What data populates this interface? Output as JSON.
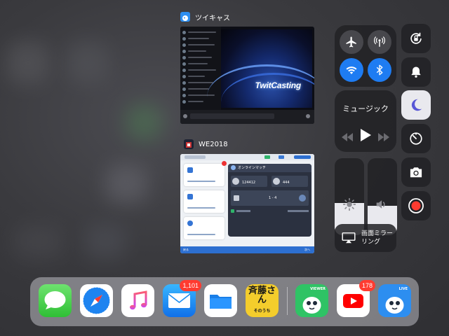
{
  "switcher": {
    "apps": [
      {
        "title": "ツイキャス",
        "preview_logo": "TwitCasting"
      },
      {
        "title": "WE2018",
        "panel_title": "オンラインマッチ",
        "stat_1": "124412",
        "stat_2": "444",
        "score": "1 - 4",
        "back_label": "戻る",
        "next_label": "次へ"
      }
    ]
  },
  "control_center": {
    "connectivity": {
      "airplane": {
        "icon": "airplane-icon",
        "active": false
      },
      "cellular": {
        "icon": "antenna-icon",
        "active": false
      },
      "wifi": {
        "icon": "wifi-icon",
        "active": true
      },
      "bluetooth": {
        "icon": "bluetooth-icon",
        "active": true
      }
    },
    "music": {
      "title": "ミュージック"
    },
    "screen_mirroring": {
      "label": "画面ミラーリング"
    },
    "brightness_level": 0.42,
    "volume_level": 0.38,
    "do_not_disturb_active": true,
    "accent_color": "#1e7cf2",
    "dnd_color": "#5856d6",
    "record_color": "#ff3b30"
  },
  "dock": {
    "apps": [
      {
        "name": "Messages",
        "icon": "messages-icon"
      },
      {
        "name": "Safari",
        "icon": "safari-icon"
      },
      {
        "name": "Music",
        "icon": "music-icon"
      },
      {
        "name": "Mail",
        "icon": "mail-icon",
        "badge": "1,101"
      },
      {
        "name": "Files",
        "icon": "files-icon"
      },
      {
        "name": "Saito-san",
        "icon": "saito-san-icon",
        "text": "斉藤さん",
        "subtext": "そのうち"
      },
      {
        "name": "TwitCasting Viewer",
        "icon": "twitcasting-viewer-icon",
        "tag": "VIEWER"
      },
      {
        "name": "YouTube",
        "icon": "youtube-icon",
        "badge": "178"
      },
      {
        "name": "TwitCasting Live",
        "icon": "twitcasting-live-icon",
        "tag": "LIVE"
      }
    ]
  }
}
